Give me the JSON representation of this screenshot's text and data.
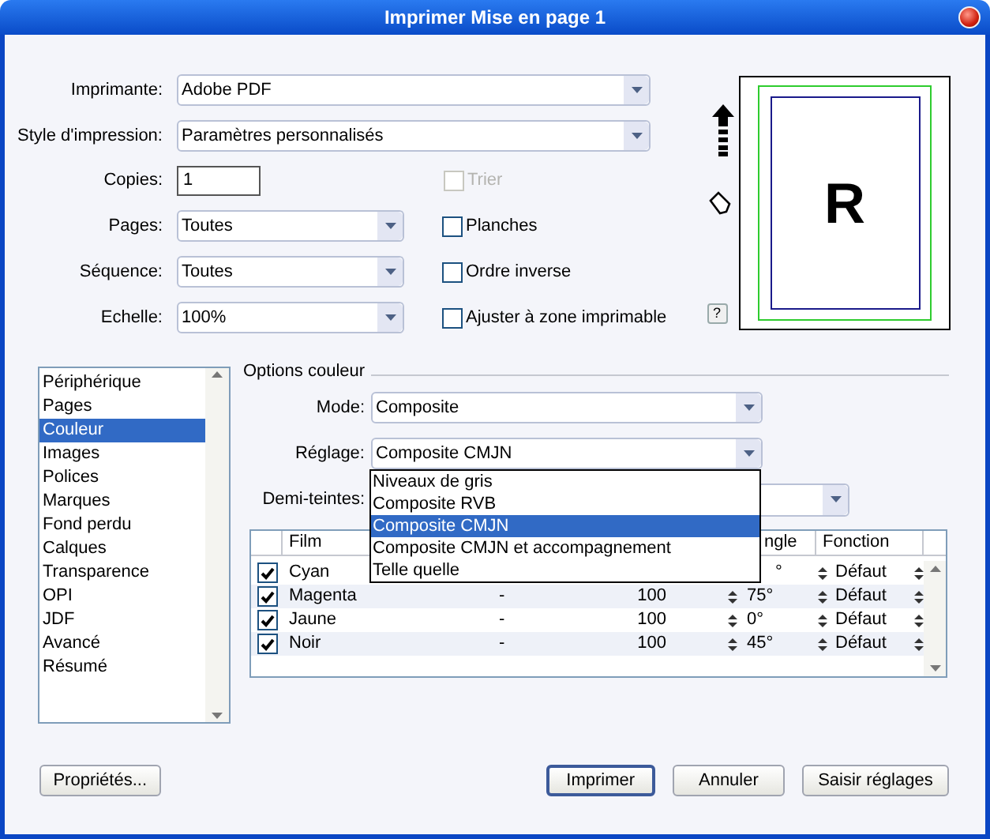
{
  "window": {
    "title": "Imprimer Mise en page 1"
  },
  "general": {
    "printer": {
      "label": "Imprimante:",
      "value": "Adobe PDF"
    },
    "print_style": {
      "label": "Style d'impression:",
      "value": "Paramètres personnalisés"
    },
    "copies": {
      "label": "Copies:",
      "value": "1"
    },
    "pages": {
      "label": "Pages:",
      "value": "Toutes"
    },
    "sequence": {
      "label": "Séquence:",
      "value": "Toutes"
    },
    "scale": {
      "label": "Echelle:",
      "value": "100%"
    },
    "options": [
      {
        "label": "Trier",
        "checked": false,
        "disabled": true
      },
      {
        "label": "Planches",
        "checked": false,
        "disabled": false
      },
      {
        "label": "Ordre inverse",
        "checked": false,
        "disabled": false
      },
      {
        "label": "Ajuster à zone imprimable",
        "checked": false,
        "disabled": false
      }
    ],
    "help_button": "?"
  },
  "preview": {
    "letter": "R"
  },
  "categories": [
    {
      "label": "Périphérique",
      "selected": false
    },
    {
      "label": "Pages",
      "selected": false
    },
    {
      "label": "Couleur",
      "selected": true
    },
    {
      "label": "Images",
      "selected": false
    },
    {
      "label": "Polices",
      "selected": false
    },
    {
      "label": "Marques",
      "selected": false
    },
    {
      "label": "Fond perdu",
      "selected": false
    },
    {
      "label": "Calques",
      "selected": false
    },
    {
      "label": "Transparence",
      "selected": false
    },
    {
      "label": "OPI",
      "selected": false
    },
    {
      "label": "JDF",
      "selected": false
    },
    {
      "label": "Avancé",
      "selected": false
    },
    {
      "label": "Résumé",
      "selected": false
    }
  ],
  "color_options": {
    "title": "Options couleur",
    "mode": {
      "label": "Mode:",
      "value": "Composite"
    },
    "setting": {
      "label": "Réglage:",
      "value": "Composite CMJN"
    },
    "halftone": {
      "label": "Demi-teintes:"
    },
    "setting_menu": [
      {
        "label": "Niveaux de gris",
        "selected": false
      },
      {
        "label": "Composite RVB",
        "selected": false
      },
      {
        "label": "Composite CMJN",
        "selected": true
      },
      {
        "label": "Composite CMJN et accompagnement",
        "selected": false
      },
      {
        "label": "Telle quelle",
        "selected": false
      }
    ],
    "table": {
      "columns": [
        "Film",
        "ngle",
        "Fonction"
      ],
      "rows": [
        {
          "checked": true,
          "film": "Cyan",
          "angle": "°",
          "function": "Défaut"
        },
        {
          "checked": true,
          "film": "Magenta",
          "column_3": "-",
          "column_4": "100",
          "angle": "75°",
          "function": "Défaut"
        },
        {
          "checked": true,
          "film": "Jaune",
          "column_3": "-",
          "column_4": "100",
          "angle": "0°",
          "function": "Défaut"
        },
        {
          "checked": true,
          "film": "Noir",
          "column_3": "-",
          "column_4": "100",
          "angle": "45°",
          "function": "Défaut"
        }
      ]
    }
  },
  "buttons": [
    {
      "label": "Propriétés...",
      "default": false
    },
    {
      "label": "Imprimer",
      "default": true
    },
    {
      "label": "Annuler",
      "default": false
    },
    {
      "label": "Saisir réglages",
      "default": false
    }
  ]
}
